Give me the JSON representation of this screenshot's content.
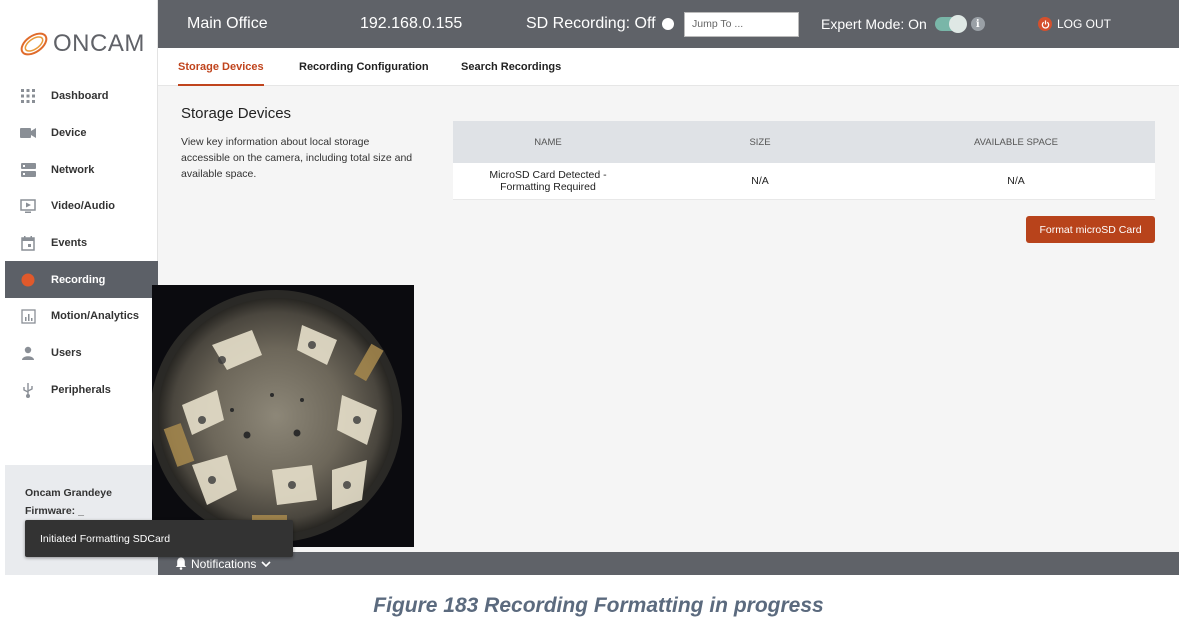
{
  "app": {
    "brand": "ONCAM",
    "colors": {
      "accent": "#c0441d",
      "topbar": "#5f6268",
      "button": "#b8431b"
    }
  },
  "topbar": {
    "site_name": "Main Office",
    "ip": "192.168.0.155",
    "sd_recording": "SD Recording: Off",
    "jump_placeholder": "Jump To ...",
    "expert_mode": "Expert Mode: On",
    "logout": "LOG OUT"
  },
  "sidebar": {
    "items": [
      {
        "label": "Dashboard",
        "icon": "grid-icon"
      },
      {
        "label": "Device",
        "icon": "camera-icon"
      },
      {
        "label": "Network",
        "icon": "server-icon"
      },
      {
        "label": "Video/Audio",
        "icon": "monitor-icon"
      },
      {
        "label": "Events",
        "icon": "calendar-icon"
      },
      {
        "label": "Recording",
        "icon": "record-icon",
        "active": true
      },
      {
        "label": "Motion/Analytics",
        "icon": "analytics-icon"
      },
      {
        "label": "Users",
        "icon": "user-icon"
      },
      {
        "label": "Peripherals",
        "icon": "usb-icon"
      }
    ],
    "device_model": "Oncam Grandeye",
    "firmware_label": "Firmware: _"
  },
  "tabs": [
    {
      "label": "Storage Devices",
      "active": true
    },
    {
      "label": "Recording Configuration"
    },
    {
      "label": "Search Recordings"
    }
  ],
  "storage": {
    "title": "Storage Devices",
    "description": "View key information about local storage accessible on the camera, including total size and available space.",
    "columns": [
      "NAME",
      "SIZE",
      "AVAILABLE SPACE"
    ],
    "rows": [
      {
        "name": "MicroSD Card Detected - Formatting Required",
        "size": "N/A",
        "available": "N/A"
      }
    ],
    "format_button": "Format microSD Card"
  },
  "bottombar": {
    "notifications": "Notifications"
  },
  "toast": {
    "message": "Initiated Formatting SDCard"
  },
  "caption": "Figure 183 Recording Formatting in progress"
}
